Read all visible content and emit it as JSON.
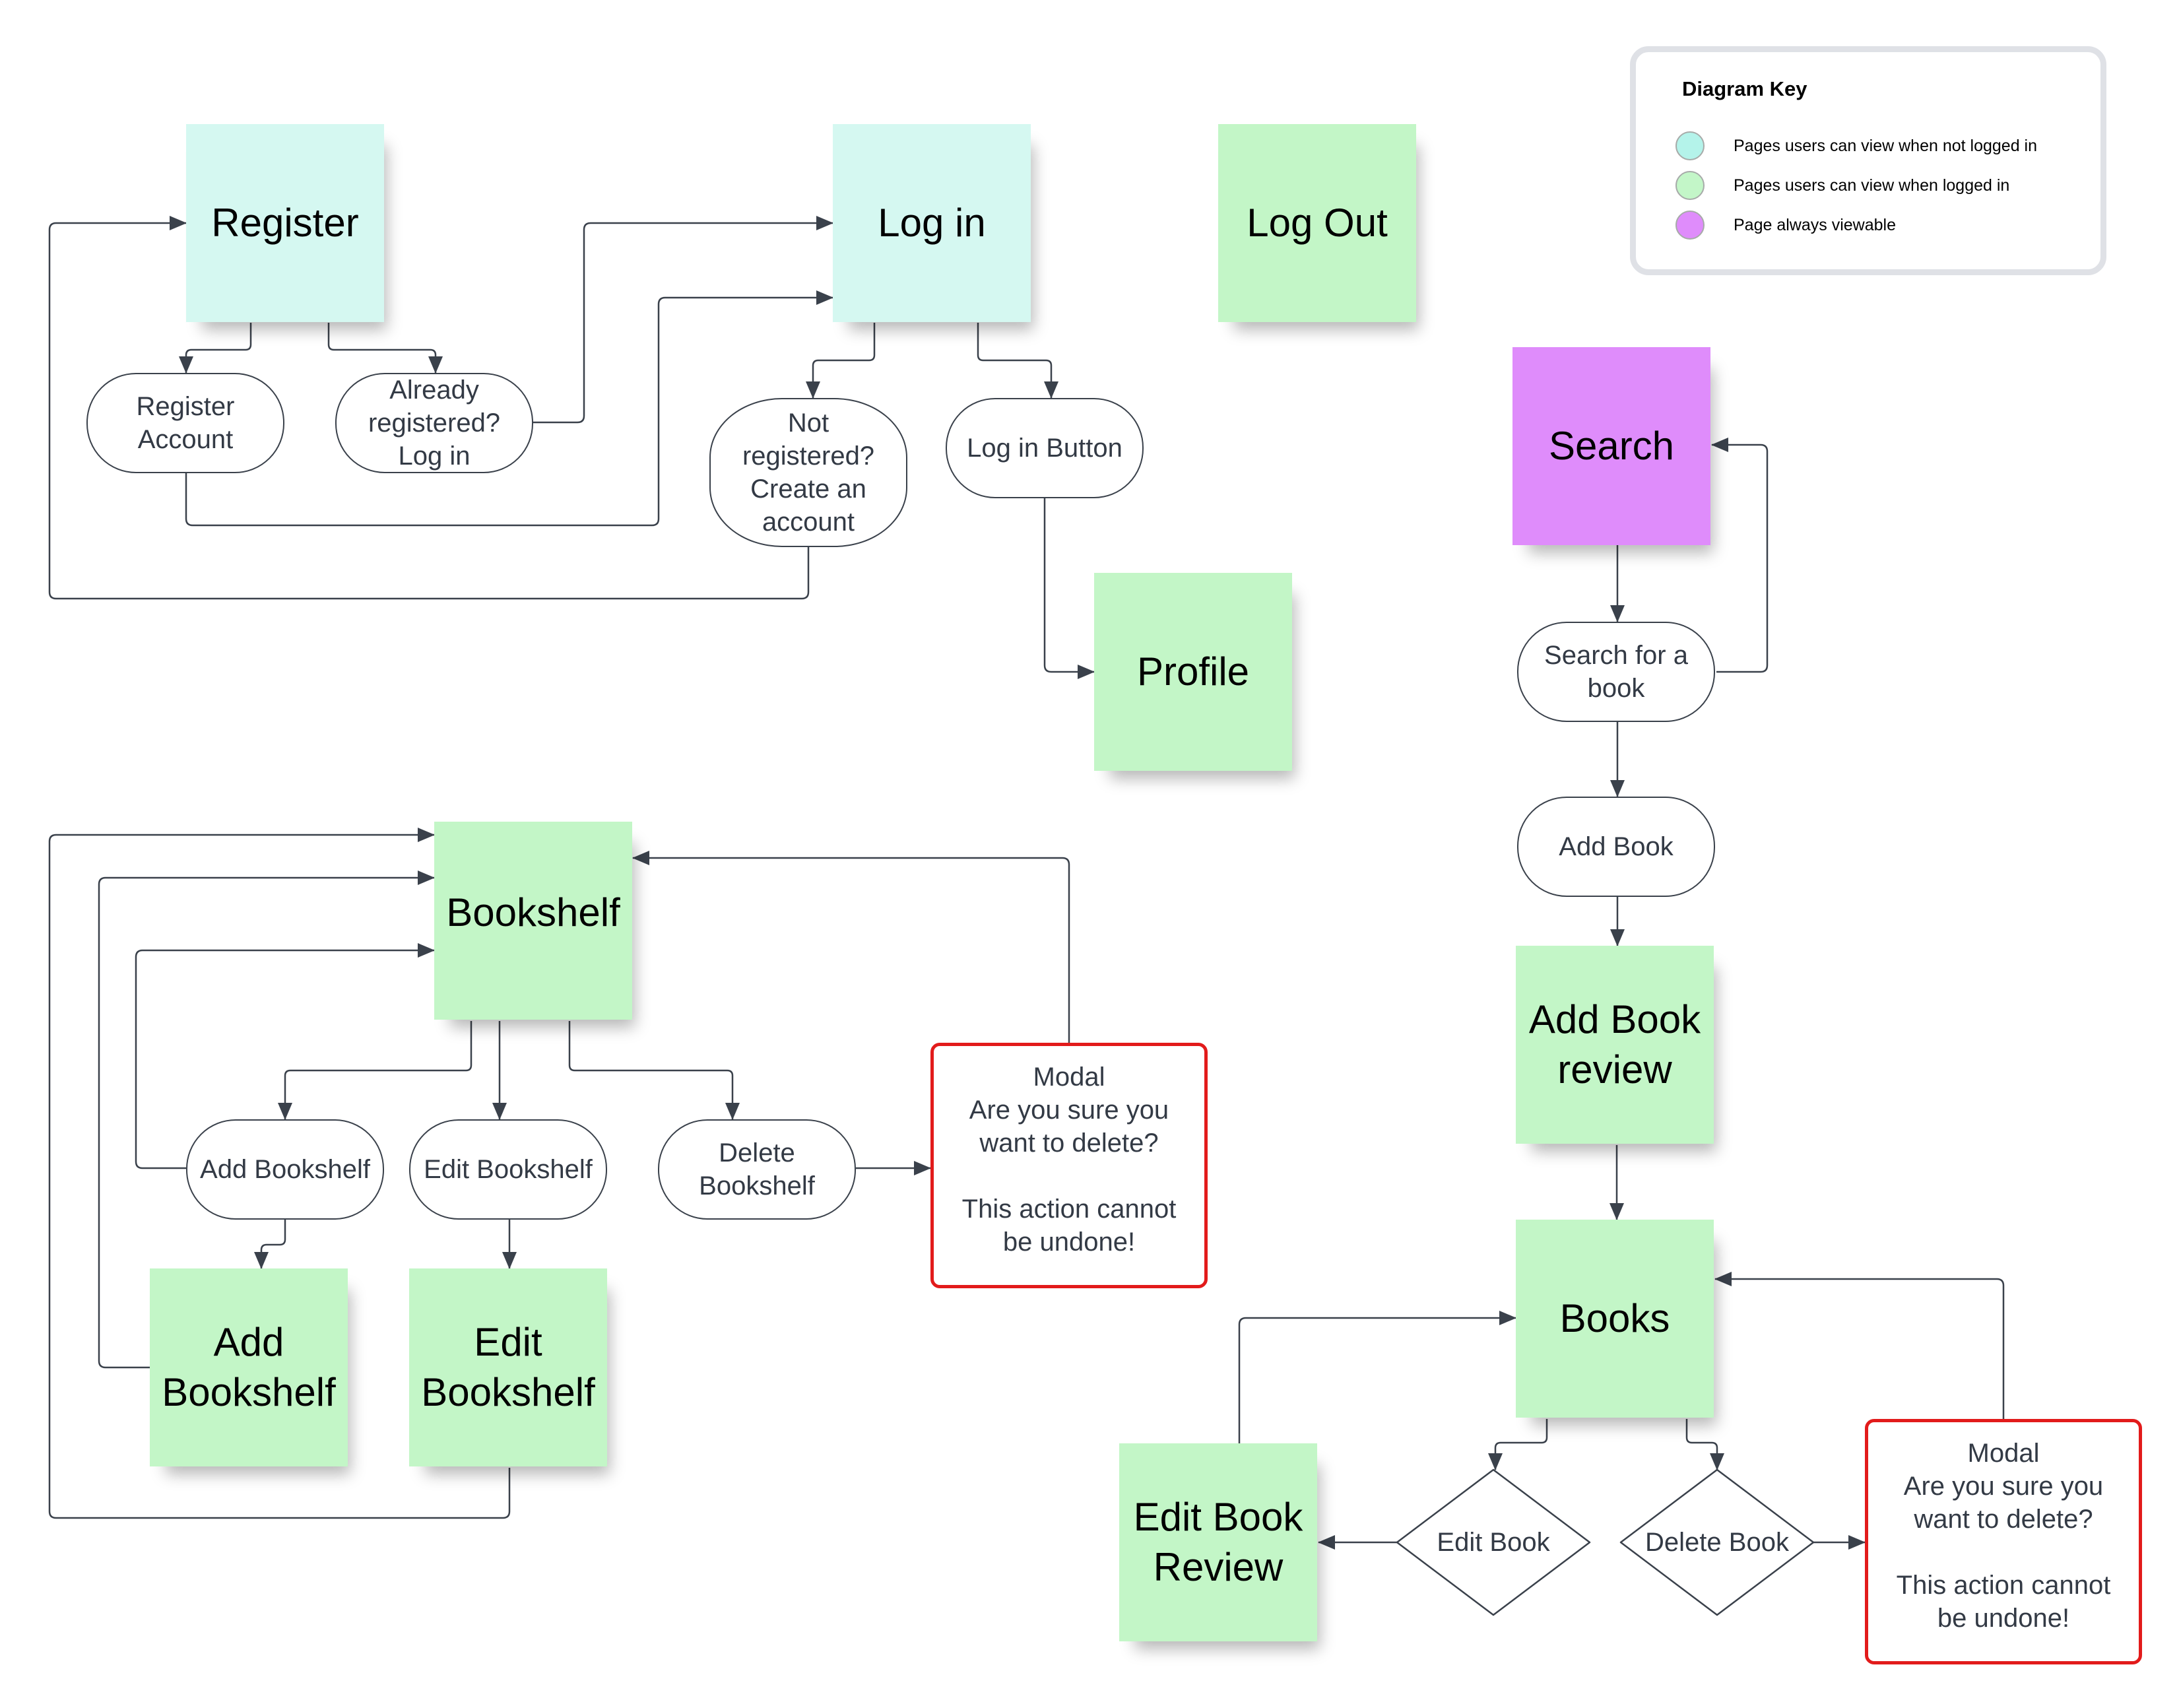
{
  "legend": {
    "title": "Diagram Key",
    "items": [
      {
        "label": "Pages users can view when not logged in",
        "color": "#b4f3ea"
      },
      {
        "label": "Pages users can view when logged in",
        "color": "#c3f6c8"
      },
      {
        "label": "Page always viewable",
        "color": "#df8cfb"
      }
    ]
  },
  "colors": {
    "logged_out_page": "#d5f8f1",
    "logged_in_page": "#c3f6c7",
    "always_page": "#df8cfb",
    "modal_border": "#e21b1b",
    "connector": "#3a414b"
  },
  "pages": {
    "register": "Register",
    "login": "Log in",
    "logout": "Log Out",
    "profile": "Profile",
    "search": "Search",
    "bookshelf": "Bookshelf",
    "add_bookshelf": "Add Bookshelf",
    "edit_bookshelf": "Edit Bookshelf",
    "add_book_review": "Add Book review",
    "books": "Books",
    "edit_book_review": "Edit Book Review"
  },
  "actions": {
    "register_account": "Register\nAccount",
    "already_registered": "Already\nregistered?\nLog in",
    "not_registered": "Not\nregistered?\nCreate an\naccount",
    "login_button": "Log in Button",
    "search_for_book": "Search  for a\nbook",
    "add_book": "Add Book",
    "add_bookshelf": "Add Bookshelf",
    "edit_bookshelf": "Edit Bookshelf",
    "delete_bookshelf": "Delete\nBookshelf",
    "edit_book": "Edit Book",
    "delete_book": "Delete Book"
  },
  "modals": {
    "delete_bookshelf_modal": "Modal\nAre you sure you\nwant to delete?\n\nThis action cannot\nbe undone!",
    "delete_book_modal": "Modal\nAre you sure you\nwant to delete?\n\nThis action cannot\nbe undone!"
  }
}
